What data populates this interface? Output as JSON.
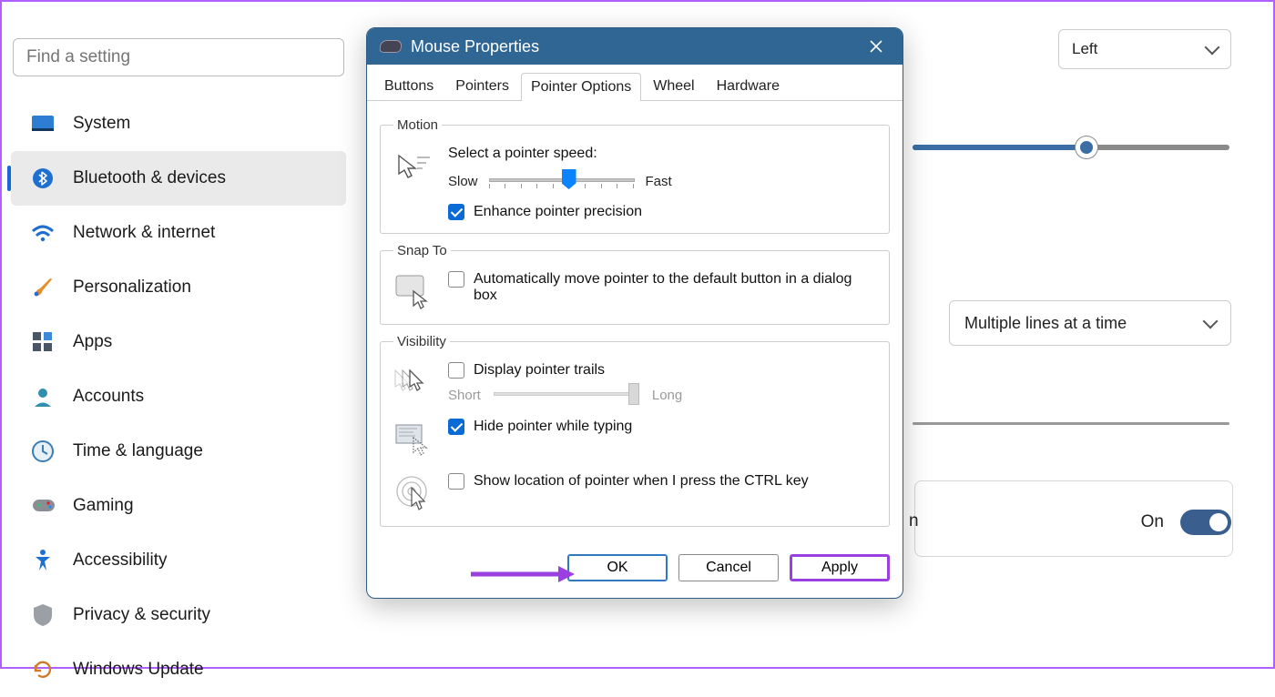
{
  "search": {
    "placeholder": "Find a setting"
  },
  "sidebar": {
    "items": [
      {
        "label": "System"
      },
      {
        "label": "Bluetooth & devices"
      },
      {
        "label": "Network & internet"
      },
      {
        "label": "Personalization"
      },
      {
        "label": "Apps"
      },
      {
        "label": "Accounts"
      },
      {
        "label": "Time & language"
      },
      {
        "label": "Gaming"
      },
      {
        "label": "Accessibility"
      },
      {
        "label": "Privacy & security"
      },
      {
        "label": "Windows Update"
      }
    ],
    "active_index": 1
  },
  "background": {
    "primary_button_dropdown": "Left",
    "scroll_dropdown": "Multiple lines at a time",
    "toggle_label": "On",
    "partial_suffix": "n"
  },
  "dialog": {
    "title": "Mouse Properties",
    "tabs": [
      "Buttons",
      "Pointers",
      "Pointer Options",
      "Wheel",
      "Hardware"
    ],
    "active_tab": 2,
    "motion": {
      "legend": "Motion",
      "prompt": "Select a pointer speed:",
      "slow": "Slow",
      "fast": "Fast",
      "enhance": "Enhance pointer precision"
    },
    "snap": {
      "legend": "Snap To",
      "text": "Automatically move pointer to the default button in a dialog box"
    },
    "visibility": {
      "legend": "Visibility",
      "trails": "Display pointer trails",
      "short": "Short",
      "long": "Long",
      "hide_typing": "Hide pointer while typing",
      "ctrl_locate": "Show location of pointer when I press the CTRL key"
    },
    "buttons": {
      "ok": "OK",
      "cancel": "Cancel",
      "apply": "Apply"
    }
  },
  "colors": {
    "accent": "#0a6bd6",
    "dialog_title": "#2f6694",
    "annotation": "#9a3fe0"
  }
}
